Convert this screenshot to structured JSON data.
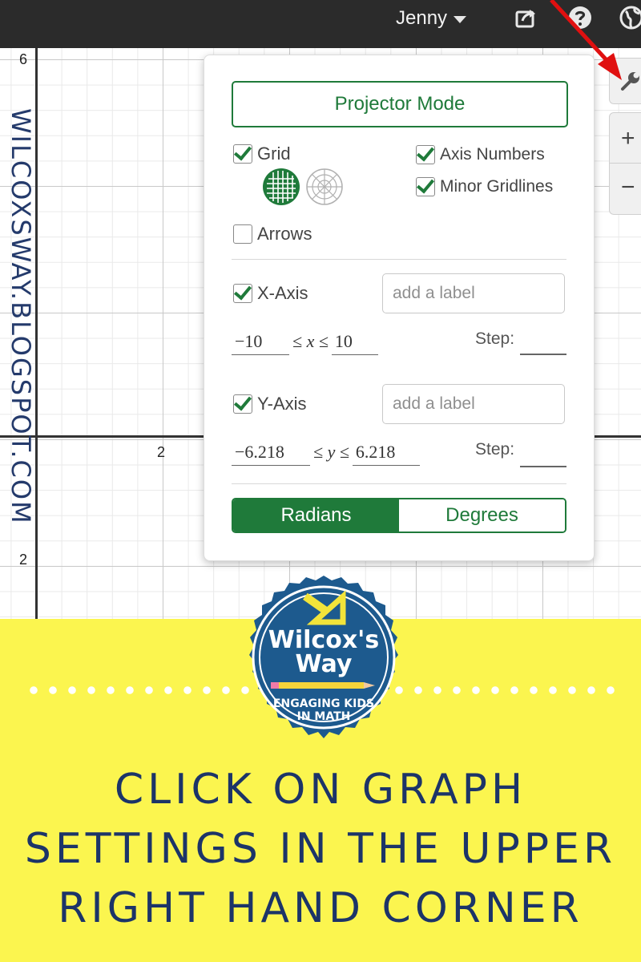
{
  "topbar": {
    "user_name": "Jenny",
    "icons": [
      "share-icon",
      "help-icon",
      "globe-icon"
    ]
  },
  "graph": {
    "y_tick_top": "6",
    "x_tick": "2",
    "y_tick_bottom": "2"
  },
  "watermark": {
    "blog_url": "WILCOXSWAY.BLOGSPOT.COM"
  },
  "tools": {
    "wrench": "wrench-icon",
    "zoom_in": "+",
    "zoom_out": "−"
  },
  "settings": {
    "projector_mode": "Projector Mode",
    "grid": {
      "label": "Grid",
      "checked": true
    },
    "axis_numbers": {
      "label": "Axis Numbers",
      "checked": true
    },
    "minor_gridlines": {
      "label": "Minor Gridlines",
      "checked": true
    },
    "arrows": {
      "label": "Arrows",
      "checked": false
    },
    "x_axis": {
      "label": "X-Axis",
      "checked": true,
      "label_placeholder": "add a label",
      "min": "−10",
      "relation": "≤ x ≤",
      "max": "10",
      "step_label": "Step:"
    },
    "y_axis": {
      "label": "Y-Axis",
      "checked": true,
      "label_placeholder": "add a label",
      "min": "−6.218",
      "relation": "≤ y ≤",
      "max": "6.218",
      "step_label": "Step:"
    },
    "angle_modes": {
      "radians": "Radians",
      "degrees": "Degrees",
      "selected": "Radians"
    }
  },
  "logo": {
    "name_line1": "Wilcox's",
    "name_line2": "Way",
    "tagline_line1": "ENGAGING KIDS",
    "tagline_line2": "IN MATH"
  },
  "banner": {
    "line1": "CLICK ON GRAPH",
    "line2": "SETTINGS IN THE UPPER",
    "line3": "RIGHT HAND CORNER"
  },
  "colors": {
    "accent_green": "#1f7a3a",
    "banner_yellow": "#fbf54f",
    "navy": "#1c3468",
    "arrow_red": "#e01010"
  }
}
